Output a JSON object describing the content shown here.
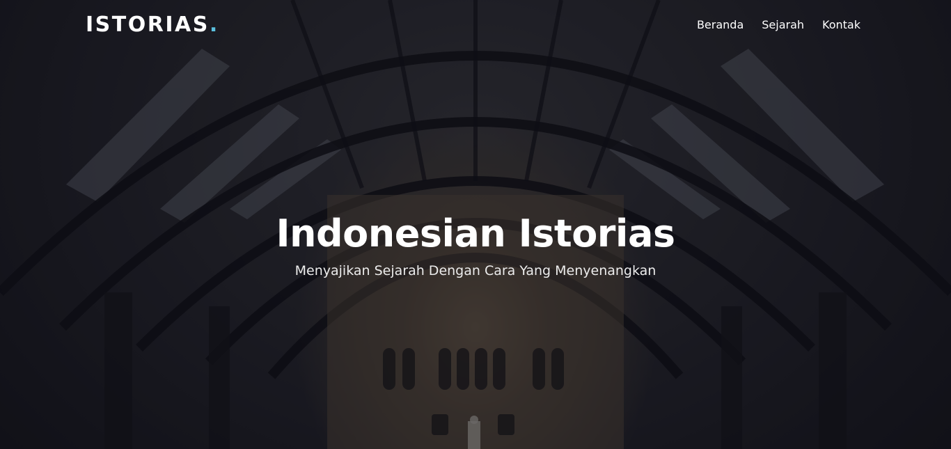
{
  "brand": {
    "name": "ISTORIAS",
    "dot": ".",
    "accent_color": "#5bc0de"
  },
  "nav": {
    "items": [
      {
        "label": "Beranda"
      },
      {
        "label": "Sejarah"
      },
      {
        "label": "Kontak"
      }
    ]
  },
  "hero": {
    "title": "Indonesian Istorias",
    "subtitle": "Menyajikan Sejarah Dengan Cara Yang Menyenangkan",
    "background_image": "museum-hall-arched-roof"
  }
}
